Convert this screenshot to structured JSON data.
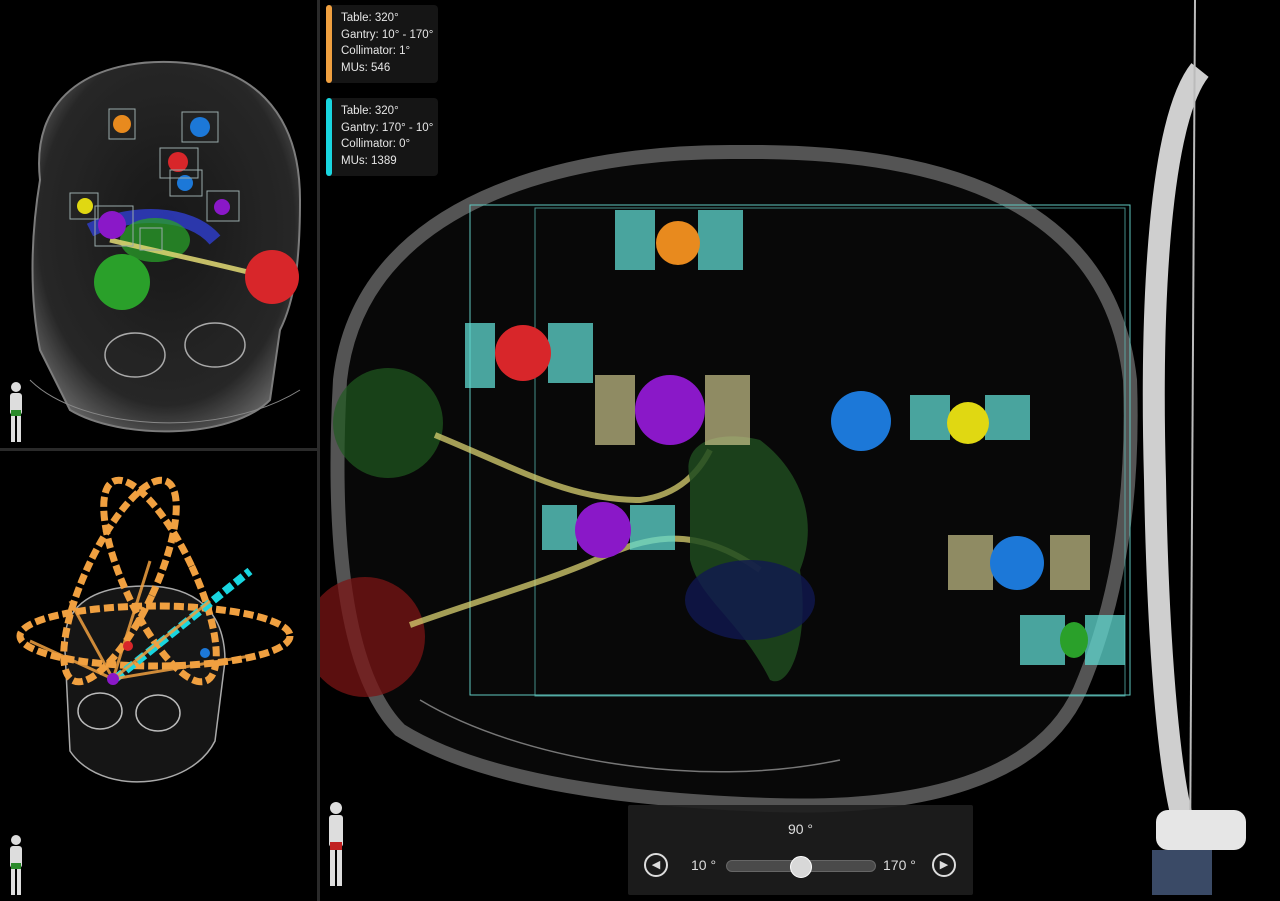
{
  "beams": [
    {
      "color": "#f0a040",
      "table": "Table: 320°",
      "gantry": "Gantry: 10° - 170°",
      "collimator": "Collimator: 1°",
      "mus": "MUs: 546"
    },
    {
      "color": "#19d6e0",
      "table": "Table: 320°",
      "gantry": "Gantry: 170° - 10°",
      "collimator": "Collimator: 0°",
      "mus": "MUs: 1389"
    }
  ],
  "slider": {
    "current": "90 °",
    "min_label": "10 °",
    "max_label": "170 °",
    "min": 10,
    "max": 170,
    "value": 90
  },
  "icons": {
    "prev": "chevron-left-icon",
    "next": "chevron-right-icon",
    "orientation": "human-figure-icon"
  },
  "colors": {
    "target_red": "#d8262a",
    "target_purple": "#8a18c8",
    "target_blue": "#1c78d8",
    "target_yellow": "#e0d812",
    "target_orange": "#e88a1e",
    "target_green": "#2aa02a",
    "mlc_cyan": "#5fd8d0",
    "mlc_khaki": "#c9c38a"
  }
}
